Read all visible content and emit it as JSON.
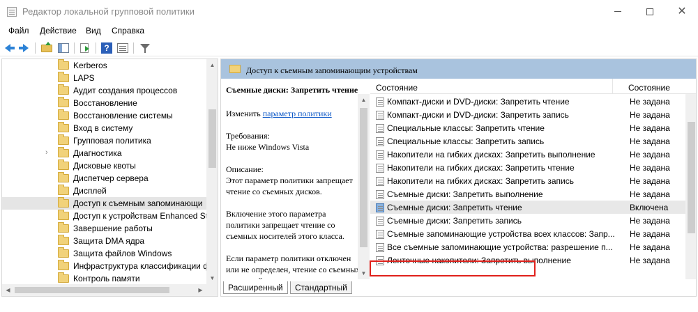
{
  "window": {
    "title": "Редактор локальной групповой политики"
  },
  "menu": [
    "Файл",
    "Действие",
    "Вид",
    "Справка"
  ],
  "tree": {
    "items": [
      {
        "label": "Kerberos",
        "selected": false,
        "expandable": false
      },
      {
        "label": "LAPS",
        "selected": false,
        "expandable": false
      },
      {
        "label": "Аудит создания процессов",
        "selected": false,
        "expandable": false
      },
      {
        "label": "Восстановление",
        "selected": false,
        "expandable": false
      },
      {
        "label": "Восстановление системы",
        "selected": false,
        "expandable": false
      },
      {
        "label": "Вход в систему",
        "selected": false,
        "expandable": false
      },
      {
        "label": "Групповая политика",
        "selected": false,
        "expandable": false
      },
      {
        "label": "Диагностика",
        "selected": false,
        "expandable": true
      },
      {
        "label": "Дисковые квоты",
        "selected": false,
        "expandable": false
      },
      {
        "label": "Диспетчер сервера",
        "selected": false,
        "expandable": false
      },
      {
        "label": "Дисплей",
        "selected": false,
        "expandable": false
      },
      {
        "label": "Доступ к съемным запоминающи",
        "selected": true,
        "expandable": false
      },
      {
        "label": "Доступ к устройствам Enhanced St",
        "selected": false,
        "expandable": false
      },
      {
        "label": "Завершение работы",
        "selected": false,
        "expandable": false
      },
      {
        "label": "Защита DMA ядра",
        "selected": false,
        "expandable": false
      },
      {
        "label": "Защита файлов Windows",
        "selected": false,
        "expandable": false
      },
      {
        "label": "Инфраструктура классификации ф",
        "selected": false,
        "expandable": false
      },
      {
        "label": "Контроль памяти",
        "selected": false,
        "expandable": false
      }
    ]
  },
  "right_pane": {
    "header_title": "Доступ к съемным запоминающим устройствам",
    "description": {
      "title": "Съемные диски: Запретить чтение",
      "edit_prefix": "Изменить ",
      "edit_link": "параметр политики",
      "requirements_label": "Требования:",
      "requirements_value": "Не ниже Windows Vista",
      "description_label": "Описание:",
      "description_text": "Этот параметр политики запрещает чтение со съемных дисков.",
      "enabled_text": "Включение этого параметра политики запрещает чтение со съемных носителей этого класса.",
      "disabled_text": "Если параметр политики отключен или не определен, чтение со съемных носителей этого класса"
    },
    "columns": {
      "setting": "Состояние",
      "state": "Состояние"
    },
    "rows": [
      {
        "name": "Компакт-диски и DVD-диски: Запретить чтение",
        "state": "Не задана",
        "active": false
      },
      {
        "name": "Компакт-диски и DVD-диски: Запретить запись",
        "state": "Не задана",
        "active": false
      },
      {
        "name": "Специальные классы: Запретить чтение",
        "state": "Не задана",
        "active": false
      },
      {
        "name": "Специальные классы: Запретить запись",
        "state": "Не задана",
        "active": false
      },
      {
        "name": "Накопители на гибких дисках: Запретить выполнение",
        "state": "Не задана",
        "active": false
      },
      {
        "name": "Накопители на гибких дисках: Запретить чтение",
        "state": "Не задана",
        "active": false
      },
      {
        "name": "Накопители на гибких дисках: Запретить запись",
        "state": "Не задана",
        "active": false
      },
      {
        "name": "Съемные диски: Запретить выполнение",
        "state": "Не задана",
        "active": false
      },
      {
        "name": "Съемные диски: Запретить чтение",
        "state": "Включена",
        "active": true
      },
      {
        "name": "Съемные диски: Запретить запись",
        "state": "Не задана",
        "active": false
      },
      {
        "name": "Съемные запоминающие устройства всех классов: Запр...",
        "state": "Не задана",
        "active": false
      },
      {
        "name": "Все съемные запоминающие устройства: разрешение п...",
        "state": "Не задана",
        "active": false
      },
      {
        "name": "Ленточные накопители: Запретить выполнение",
        "state": "Не задана",
        "active": false
      }
    ],
    "highlight_color": "#e0201b"
  },
  "tabs": [
    "Расширенный",
    "Стандартный"
  ]
}
